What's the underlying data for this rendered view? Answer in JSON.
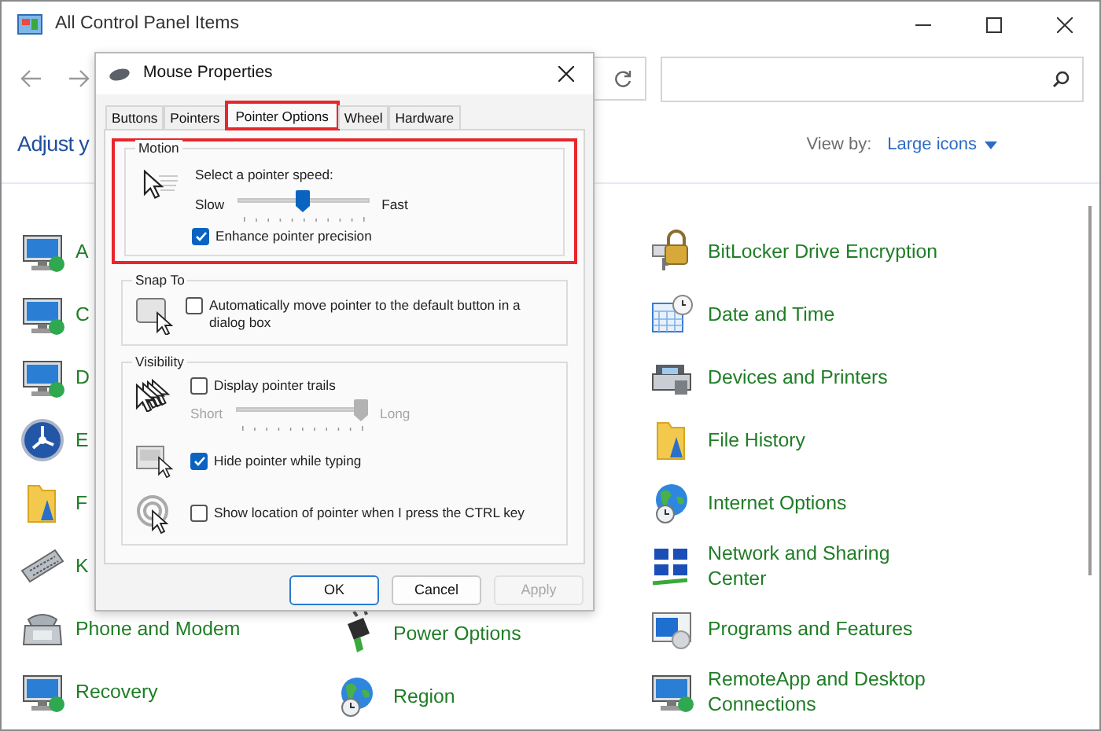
{
  "window": {
    "title": "All Control Panel Items"
  },
  "header": {
    "title": "Adjust y",
    "view_by_label": "View by:",
    "view_by_value": "Large icons"
  },
  "columns": [
    {
      "items": [
        {
          "label": "A"
        },
        {
          "label": "C"
        },
        {
          "label": "D"
        },
        {
          "label": "E"
        },
        {
          "label": "F"
        },
        {
          "label": "K"
        },
        {
          "label": "Phone and Modem"
        },
        {
          "label": "Recovery"
        }
      ]
    },
    {
      "items": [
        {
          "label": "Power Options"
        },
        {
          "label": "Region"
        }
      ]
    },
    {
      "items": [
        {
          "label": "BitLocker Drive Encryption"
        },
        {
          "label": "Date and Time"
        },
        {
          "label": "Devices and Printers"
        },
        {
          "label": "File History"
        },
        {
          "label": "Internet Options"
        },
        {
          "label": "Network and Sharing\nCenter"
        },
        {
          "label": "Programs and Features"
        },
        {
          "label": "RemoteApp and Desktop\nConnections"
        }
      ]
    }
  ],
  "dialog": {
    "title": "Mouse Properties",
    "tabs": [
      {
        "label": "Buttons",
        "selected": false,
        "highlighted": false
      },
      {
        "label": "Pointers",
        "selected": false,
        "highlighted": false
      },
      {
        "label": "Pointer Options",
        "selected": true,
        "highlighted": true
      },
      {
        "label": "Wheel",
        "selected": false,
        "highlighted": false
      },
      {
        "label": "Hardware",
        "selected": false,
        "highlighted": false
      }
    ],
    "motion": {
      "title": "Motion",
      "highlighted": true,
      "speed_label": "Select a pointer speed:",
      "slider": {
        "min_label": "Slow",
        "max_label": "Fast",
        "level": 0.5,
        "disabled": false
      },
      "precision": {
        "label": "Enhance pointer precision",
        "checked": true
      }
    },
    "snap_to": {
      "title": "Snap To",
      "option": {
        "label": "Automatically move pointer to the default button in a dialog box",
        "checked": false
      }
    },
    "visibility": {
      "title": "Visibility",
      "trails": {
        "label": "Display pointer trails",
        "checked": false
      },
      "trail_slider": {
        "min_label": "Short",
        "max_label": "Long",
        "level": 1.0,
        "disabled": true
      },
      "hide": {
        "label": "Hide pointer while typing",
        "checked": true
      },
      "locate": {
        "label": "Show location of pointer when I press the CTRL key",
        "checked": false
      }
    },
    "buttons": [
      {
        "label": "OK",
        "default": true,
        "disabled": false
      },
      {
        "label": "Cancel",
        "default": false,
        "disabled": false
      },
      {
        "label": "Apply",
        "default": false,
        "disabled": true
      }
    ]
  }
}
